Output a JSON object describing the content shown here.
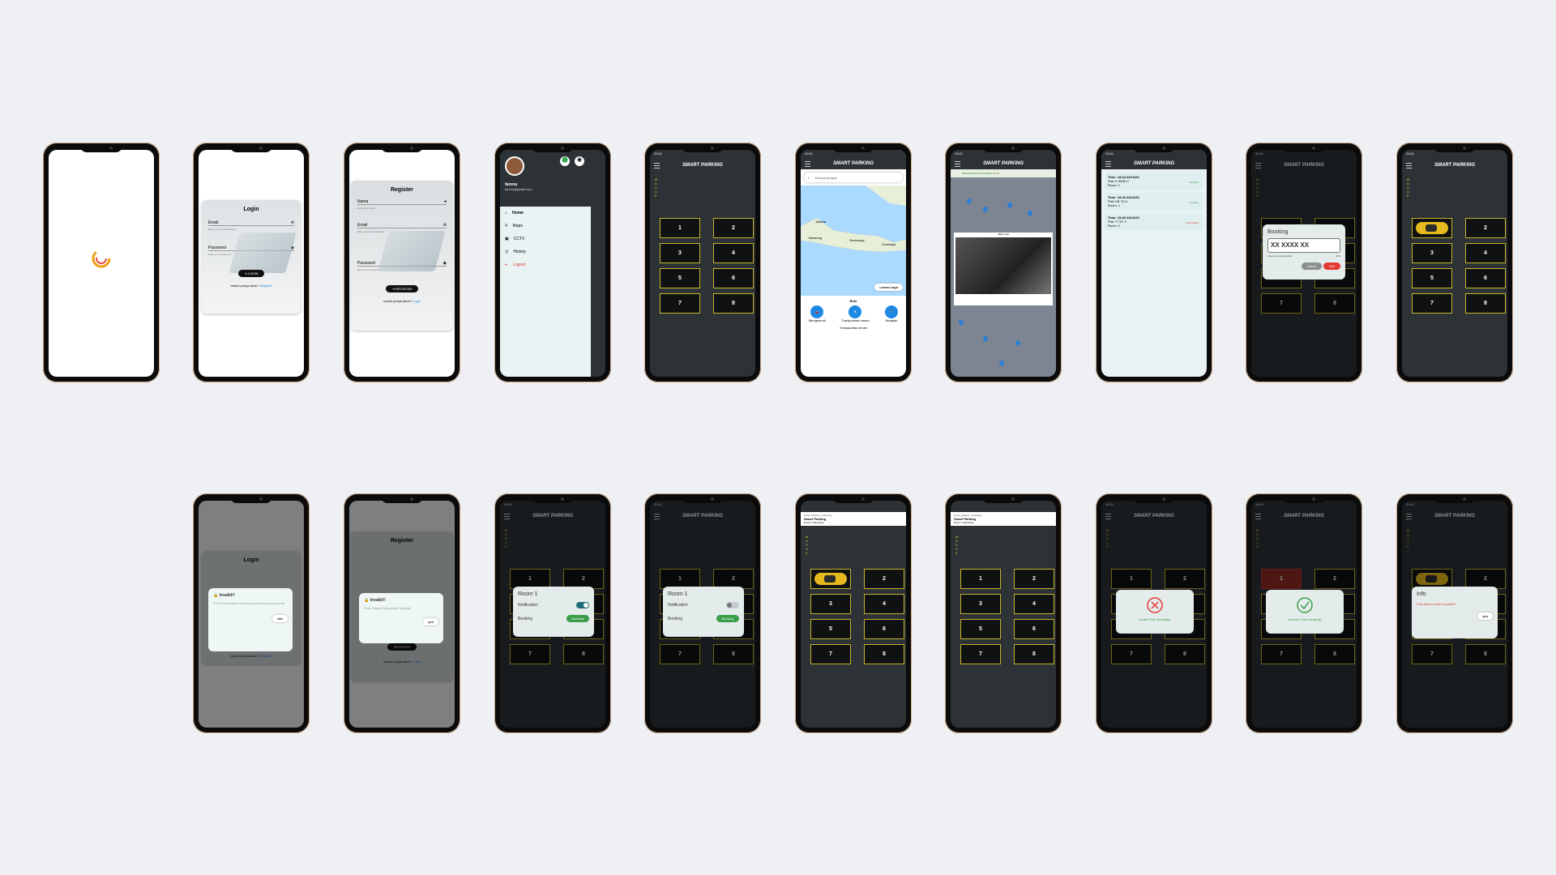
{
  "app": {
    "title": "SMART PARKING",
    "vertical_label": "MASUK",
    "time": "20:01"
  },
  "colors": {
    "background": "#eef0f4",
    "dark_screen": "#2c3236",
    "slot_border": "#c7b42a",
    "accent_green": "#3a9d47",
    "accent_red": "#e53935",
    "link_blue": "#1e88e5"
  },
  "slots": [
    "1",
    "2",
    "3",
    "4",
    "5",
    "6",
    "7",
    "8"
  ],
  "login": {
    "title": "Login",
    "email_label": "Email",
    "email_hint": "Enter your email address",
    "password_label": "Password",
    "password_hint": "Enter your password",
    "button": "LOGIN",
    "footer_text": "belum punya akun?",
    "footer_link": "Register"
  },
  "register": {
    "title": "Register",
    "name_label": "Nama",
    "name_hint": "Enter your name",
    "email_label": "Email",
    "email_hint": "Enter your email address",
    "password_label": "Password",
    "password_hint": "Enter your password",
    "button": "REGISTER",
    "footer_text": "sudah punya akun?",
    "footer_link": "Login"
  },
  "drawer": {
    "user_name": "farena",
    "user_email": "farena@gmail.com",
    "items": [
      "Home",
      "Maps",
      "CCTV",
      "History",
      "Logout"
    ]
  },
  "maps": {
    "search_placeholder": "Telusuri tempat",
    "cities": [
      "Jakarta",
      "Bandung",
      "Semarang",
      "Surabaya"
    ],
    "mode_label": "Rute",
    "modes": [
      "Mengemudi",
      "Transportasi umum",
      "Berjalan"
    ],
    "footer": "Transportasi umum",
    "layer_btn": "Lokasi saya"
  },
  "cctv": {
    "top_text": "MENGGUNAKAN KAMERA CCTV",
    "overlay_title": "Jalan raya"
  },
  "history": [
    {
      "time": "Time: 13:44 24/12/23",
      "plat": "Plat: H 3500 C",
      "room": "Room: 1",
      "status": "Success",
      "status_color": "#3a9d47"
    },
    {
      "time": "Time: 13:43 24/12/23",
      "plat": "Plat: KB 73 H",
      "room": "Room: 1",
      "status": "Success",
      "status_color": "#3a9d47"
    },
    {
      "time": "Time: 13:40 24/12/23",
      "plat": "Plat: T 727 Y",
      "room": "Room: 1",
      "status": "Not booked",
      "status_color": "#e53935"
    }
  ],
  "booking_dialog": {
    "title": "Booking",
    "placeholder": "XX XXXX XX",
    "hint": "enter your plat number",
    "counter": "0/11",
    "cancel": "cancel",
    "ok": "Oke"
  },
  "invalid_login": {
    "title": "Invalid!!",
    "body": "Error! Masukkan email atau password yang benar",
    "button": "oke"
  },
  "invalid_register": {
    "title": "Invalid!!",
    "body": "Pada Bagian Masukkan Register",
    "button": "yes"
  },
  "room_dialog": {
    "title": "Room 1",
    "notification": "Notification",
    "booking": "Booking",
    "booking_btn": "Booking"
  },
  "notification_banner": {
    "app": "smart_parking • sekarang",
    "title": "Smart Parking",
    "body": "Room 1 dibooking"
  },
  "invalid_booking": {
    "text": "Invalid Your Bookings"
  },
  "success_booking": {
    "text": "Success Your Booking!!"
  },
  "info_dialog": {
    "title": "Info",
    "body": "Pola kamu masih di parkir!!",
    "button": "yes"
  }
}
